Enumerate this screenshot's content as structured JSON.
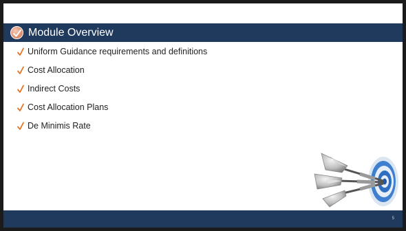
{
  "header": {
    "title": "Module Overview",
    "bar_color": "#1f3a5c",
    "badge_icon": "checkmark-badge-icon"
  },
  "bullets": {
    "icon": "orange-checkmark-icon",
    "check_color": "#e8731f",
    "items": [
      "Uniform Guidance requirements and definitions",
      "Cost Allocation",
      "Indirect Costs",
      "Cost Allocation Plans",
      "De Minimis Rate"
    ]
  },
  "illustration": {
    "icon": "darts-target-icon"
  },
  "footer": {
    "page_number": "5",
    "bar_color": "#1f3a5c"
  }
}
